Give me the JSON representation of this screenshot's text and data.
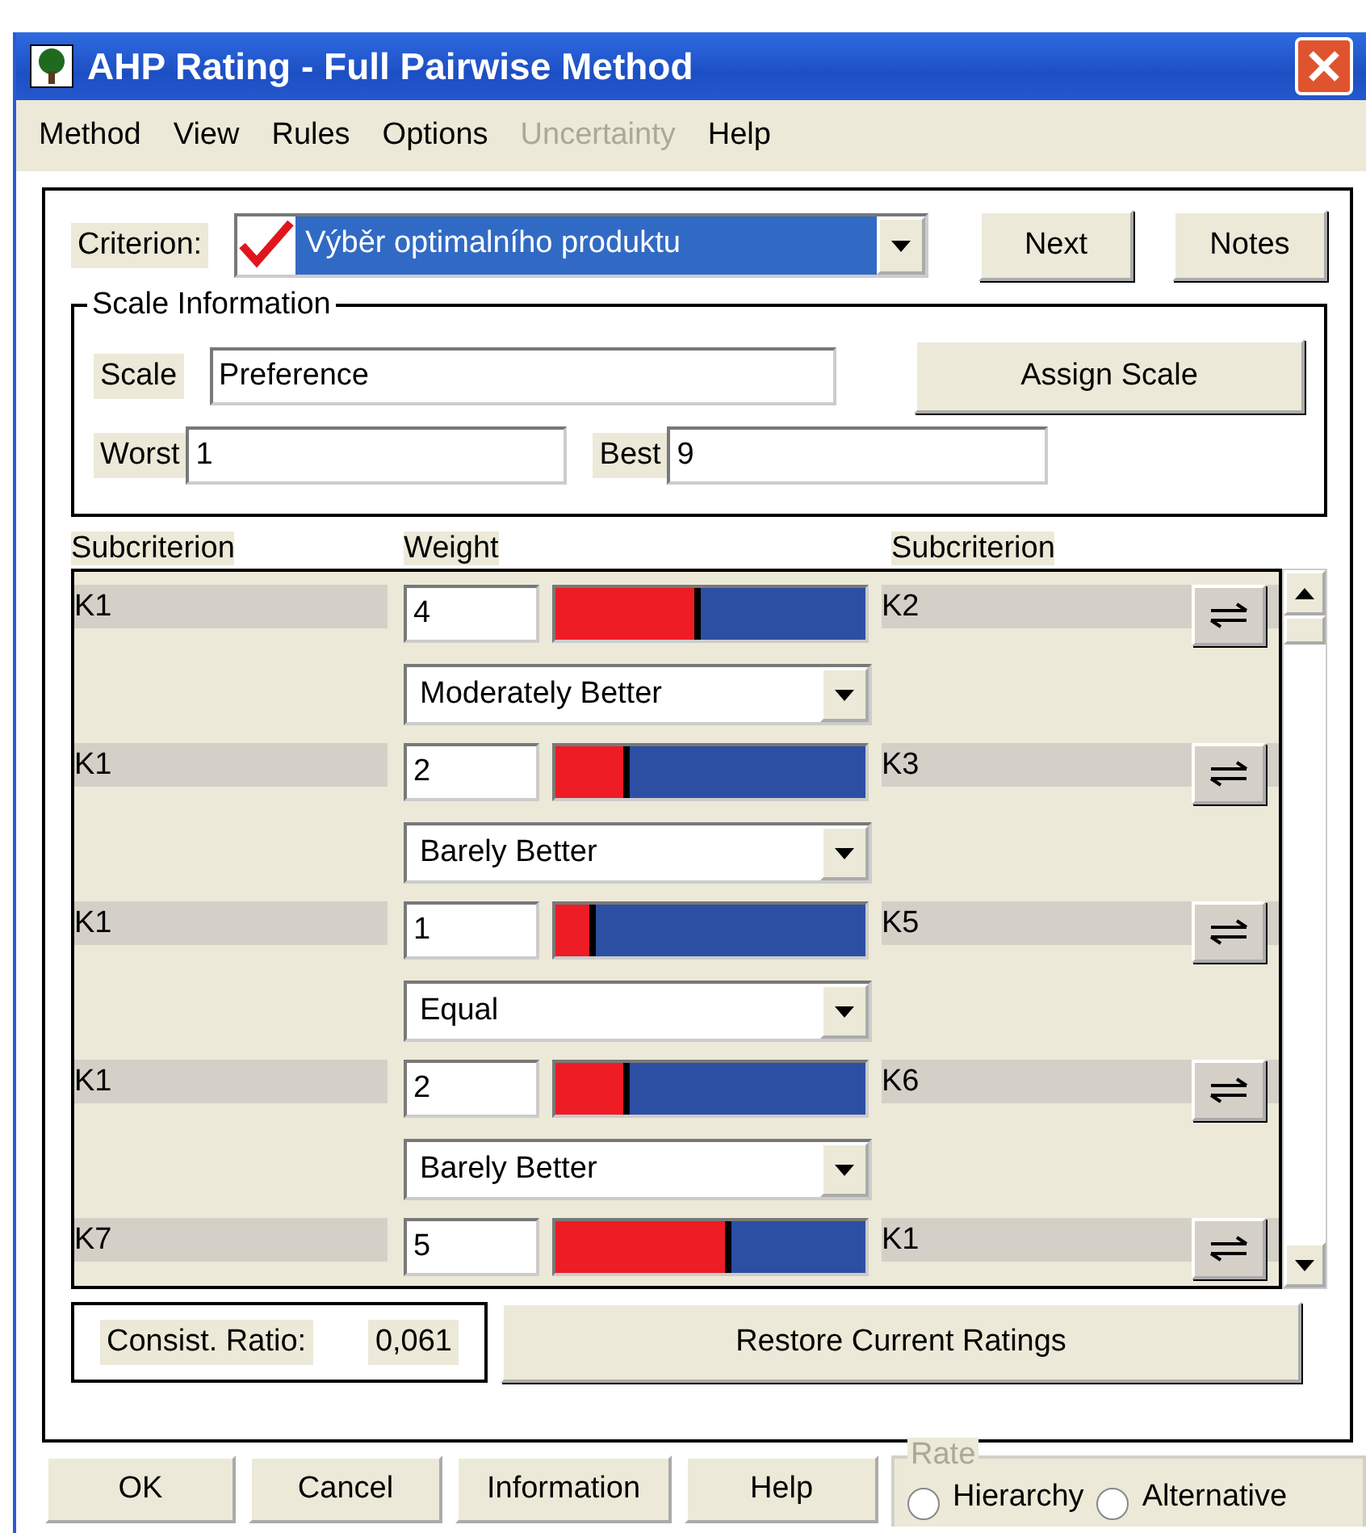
{
  "window": {
    "title": "AHP Rating - Full Pairwise Method"
  },
  "menu": [
    {
      "label": "Method",
      "disabled": false
    },
    {
      "label": "View",
      "disabled": false
    },
    {
      "label": "Rules",
      "disabled": false
    },
    {
      "label": "Options",
      "disabled": false
    },
    {
      "label": "Uncertainty",
      "disabled": true
    },
    {
      "label": "Help",
      "disabled": false
    }
  ],
  "criterion": {
    "label": "Criterion:",
    "value": "Výběr optimalního produktu",
    "checked": true
  },
  "top_buttons": [
    "Next",
    "Notes"
  ],
  "scale_information": {
    "title": "Scale Information",
    "scale_label": "Scale",
    "scale": "Preference",
    "assign_button": "Assign Scale",
    "worst_label": "Worst",
    "worst": "1",
    "best_label": "Best",
    "best": "9"
  },
  "columns": [
    "Subcriterion",
    "Weight",
    "Subcriterion"
  ],
  "comparisons": [
    {
      "left": "K1",
      "weight": "4",
      "level": 0.47,
      "verbal": "Moderately Better",
      "right": "K2"
    },
    {
      "left": "K1",
      "weight": "2",
      "level": 0.24,
      "verbal": "Barely Better",
      "right": "K3"
    },
    {
      "left": "K1",
      "weight": "1",
      "level": 0.13,
      "verbal": "Equal",
      "right": "K5"
    },
    {
      "left": "K1",
      "weight": "2",
      "level": 0.24,
      "verbal": "Barely Better",
      "right": "K6"
    },
    {
      "left": "K7",
      "weight": "5",
      "level": 0.57,
      "right": "K1"
    }
  ],
  "consistency": {
    "label": "Consist. Ratio:",
    "value": "0,061"
  },
  "restore_button": "Restore Current Ratings",
  "bottom_buttons": [
    "OK",
    "Cancel",
    "Information",
    "Help"
  ],
  "rate": {
    "title": "Rate",
    "options": [
      {
        "label": "Hierarchy",
        "selected": false
      },
      {
        "label": "Alternative",
        "selected": false
      }
    ]
  }
}
